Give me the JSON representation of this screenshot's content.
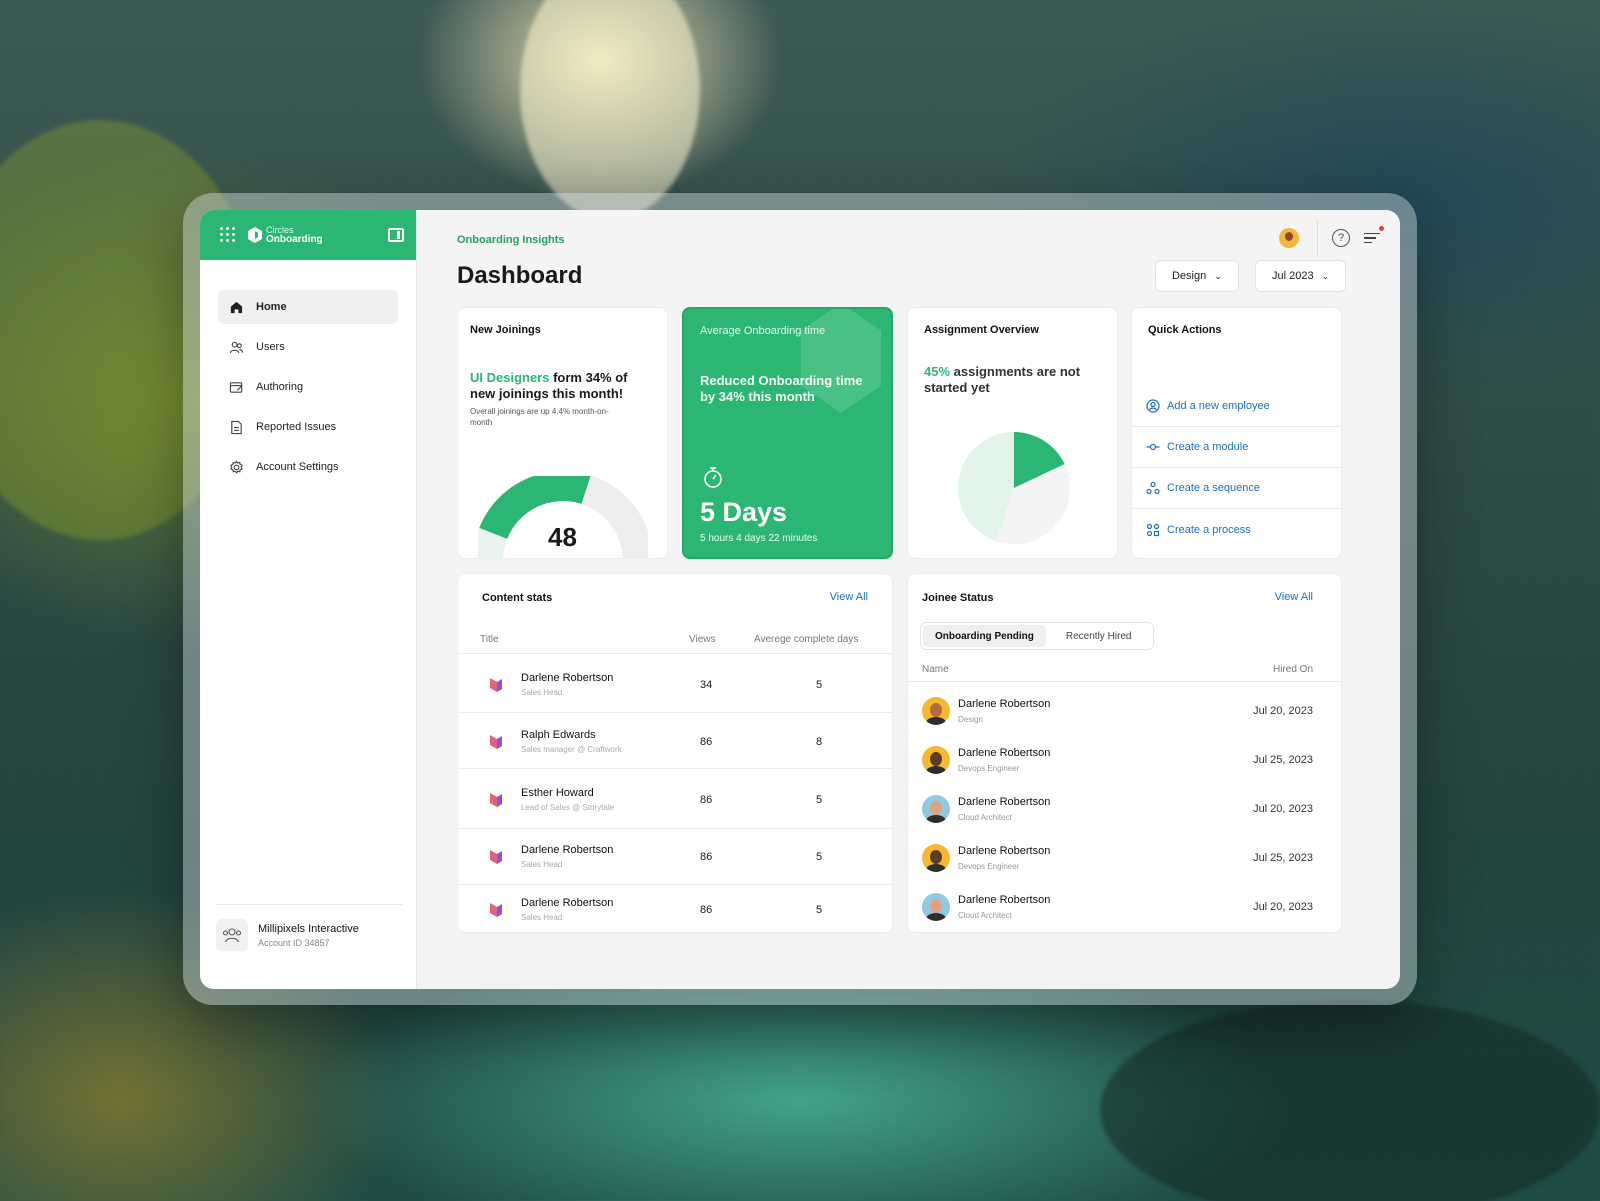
{
  "sidebar": {
    "brand_line1": "Circles",
    "brand_line2": "Onboarding",
    "items": [
      {
        "label": "Home",
        "icon": "home-icon"
      },
      {
        "label": "Users",
        "icon": "users-icon"
      },
      {
        "label": "Authoring",
        "icon": "authoring-icon"
      },
      {
        "label": "Reported Issues",
        "icon": "reported-issues-icon"
      },
      {
        "label": "Account Settings",
        "icon": "settings-icon"
      }
    ],
    "account": {
      "name": "Millipixels Interactive",
      "id": "Account ID 34857"
    }
  },
  "header": {
    "breadcrumb": "Onboarding Insights",
    "title": "Dashboard",
    "filter_team": "Design",
    "filter_month": "Jul 2023"
  },
  "new_joinings": {
    "title": "New Joinings",
    "highlight": "UI Designers",
    "headline_rest": " form 34% of new joinings this month!",
    "sub": "Overall joinings are up 4.4% month-on-month",
    "value": "48",
    "gauge_fraction": 0.6
  },
  "avg_onboarding": {
    "title": "Average Onboarding time",
    "headline": "Reduced Onboarding time by 34% this month",
    "days": "5 Days",
    "detail": "5 hours 4 days 22 minutes"
  },
  "assignment": {
    "title": "Assignment Overview",
    "percent": "45%",
    "headline_rest": " assignments are not started yet",
    "slices": [
      {
        "name": "not started",
        "value": 45,
        "color": "#e2f4ea"
      },
      {
        "name": "highlight",
        "value": 18,
        "color": "#2bb673"
      },
      {
        "name": "rest",
        "value": 37,
        "color": "#f4f4f4"
      }
    ]
  },
  "quick_actions": {
    "title": "Quick Actions",
    "items": [
      {
        "label": "Add a new employee",
        "icon": "add-employee-icon"
      },
      {
        "label": "Create a module",
        "icon": "module-icon"
      },
      {
        "label": "Create a sequence",
        "icon": "sequence-icon"
      },
      {
        "label": "Create a process",
        "icon": "process-icon"
      }
    ]
  },
  "content_stats": {
    "title": "Content stats",
    "view_all": "View All",
    "columns": {
      "title": "Title",
      "views": "Views",
      "days": "Averege complete days"
    },
    "rows": [
      {
        "name": "Darlene Robertson",
        "role": "Sales Head",
        "views": "34",
        "days": "5"
      },
      {
        "name": "Ralph Edwards",
        "role": "Sales manager @ Craftwork",
        "views": "86",
        "days": "8"
      },
      {
        "name": "Esther Howard",
        "role": "Lead of Sales @ Storytale",
        "views": "86",
        "days": "5"
      },
      {
        "name": "Darlene Robertson",
        "role": "Sales Head",
        "views": "86",
        "days": "5"
      },
      {
        "name": "Darlene Robertson",
        "role": "Sales Head",
        "views": "86",
        "days": "5"
      }
    ]
  },
  "joinee_status": {
    "title": "Joinee Status",
    "view_all": "View All",
    "tab_active": "Onboarding Pending",
    "tab_other": "Recently Hired",
    "columns": {
      "name": "Name",
      "hired": "Hired On"
    },
    "rows": [
      {
        "name": "Darlene Robertson",
        "role": "Design",
        "date": "Jul 20, 2023",
        "bg": "#f5b82e",
        "skin": "#b36b45"
      },
      {
        "name": "Darlene Robertson",
        "role": "Devops Engineer",
        "date": "Jul 25, 2023",
        "bg": "#f5b82e",
        "skin": "#5b3a28"
      },
      {
        "name": "Darlene Robertson",
        "role": "Cloud Architect",
        "date": "Jul 20, 2023",
        "bg": "#8fc9e4",
        "skin": "#e0a27e"
      },
      {
        "name": "Darlene Robertson",
        "role": "Devops Engineer",
        "date": "Jul 25, 2023",
        "bg": "#f5b82e",
        "skin": "#5b3a28"
      },
      {
        "name": "Darlene Robertson",
        "role": "Cloud Architect",
        "date": "Jul 20, 2023",
        "bg": "#8fc9e4",
        "skin": "#e0a27e"
      }
    ]
  },
  "colors": {
    "accent": "#2bb673",
    "link": "#1d6fc2"
  }
}
